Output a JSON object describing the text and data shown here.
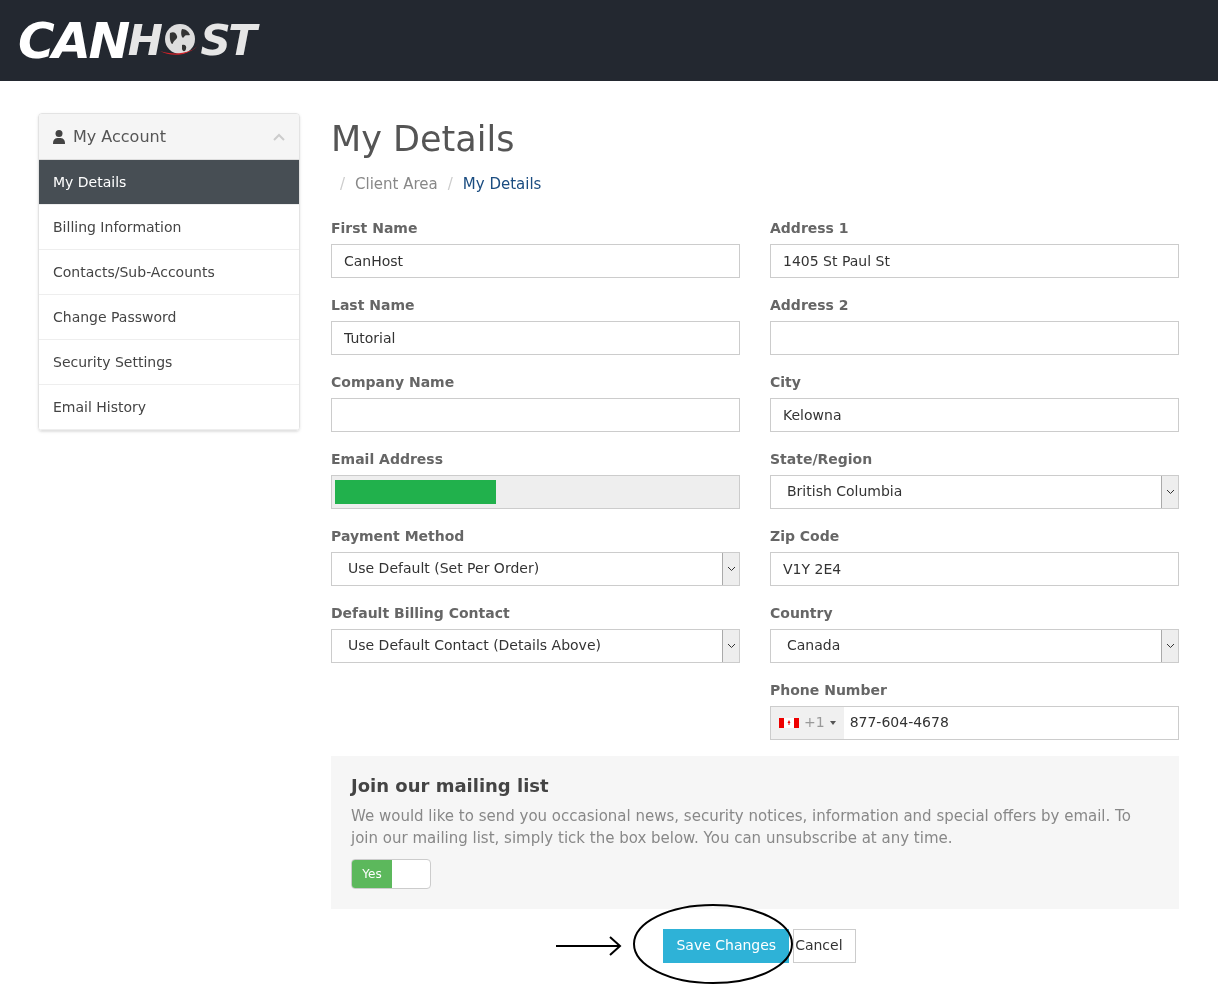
{
  "logo": {
    "parts": [
      "CAN",
      "H",
      "ST"
    ]
  },
  "sidebar": {
    "title": "My Account",
    "expanded": true,
    "items": [
      {
        "label": "My Details",
        "selected": true
      },
      {
        "label": "Billing Information",
        "selected": false
      },
      {
        "label": "Contacts/Sub-Accounts",
        "selected": false
      },
      {
        "label": "Change Password",
        "selected": false
      },
      {
        "label": "Security Settings",
        "selected": false
      },
      {
        "label": "Email History",
        "selected": false
      }
    ]
  },
  "page_title": "My Details",
  "breadcrumb": [
    {
      "separator": "/",
      "label": "Client Area",
      "selected": false
    },
    {
      "separator": "/",
      "label": "My Details",
      "selected": true
    }
  ],
  "left_fields": [
    {
      "kind": "text",
      "label": "First Name",
      "value": "CanHost"
    },
    {
      "kind": "text",
      "label": "Last Name",
      "value": "Tutorial"
    },
    {
      "kind": "text",
      "label": "Company Name"
    },
    {
      "kind": "redacted",
      "label": "Email Address"
    },
    {
      "kind": "select",
      "label": "Payment Method",
      "value": "Use Default (Set Per Order)"
    },
    {
      "kind": "select",
      "label": "Default Billing Contact",
      "value": "Use Default Contact (Details Above)"
    }
  ],
  "right_fields": [
    {
      "kind": "text",
      "label": "Address 1",
      "value": "1405 St Paul St"
    },
    {
      "kind": "text",
      "label": "Address 2"
    },
    {
      "kind": "text",
      "label": "City",
      "value": "Kelowna"
    },
    {
      "kind": "select",
      "label": "State/Region",
      "value": "British Columbia"
    },
    {
      "kind": "text",
      "label": "Zip Code",
      "value": "V1Y 2E4"
    },
    {
      "kind": "select",
      "label": "Country",
      "value": "Canada"
    },
    {
      "kind": "phone",
      "label": "Phone Number",
      "code": "+1",
      "value": "877-604-4678"
    }
  ],
  "mailing": {
    "title": "Join our mailing list",
    "text": "We would like to send you occasional news, security notices, information and special offers by email. To join our mailing list, simply tick the box below. You can unsubscribe at any time.",
    "toggle": {
      "label": "Yes",
      "on": true
    }
  },
  "buttons": {
    "save": "Save Changes",
    "cancel": "Cancel"
  }
}
